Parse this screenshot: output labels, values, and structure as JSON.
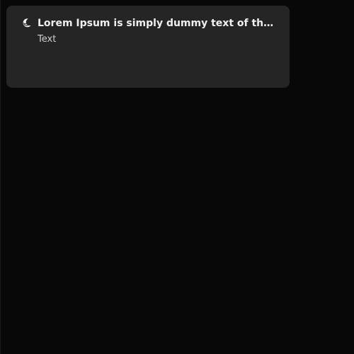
{
  "notification": {
    "icon": "moon-icon",
    "title": "Lorem Ipsum is simply dummy text of the printing and typesetting industry.",
    "body": "Text"
  },
  "colors": {
    "background": "#080808",
    "card": "#252525",
    "title": "#f0f0f0",
    "body": "#cfcfcf"
  }
}
